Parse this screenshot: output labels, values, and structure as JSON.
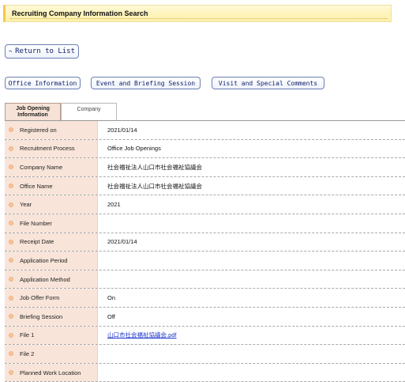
{
  "page": {
    "title": "Recruiting Company Information Search"
  },
  "actions": {
    "return_label": "Return to List"
  },
  "categories": {
    "office": "Office Information",
    "event": "Event and Briefing Session",
    "visit": "Visit and Special Comments"
  },
  "tabs": [
    {
      "label": "Job Opening Information",
      "active": true
    },
    {
      "label": "Company",
      "active": false
    }
  ],
  "fields": [
    {
      "label": "Registered on",
      "value": "2021/01/14"
    },
    {
      "label": "Recruitment Process",
      "value": "Office Job Openings"
    },
    {
      "label": "Company Name",
      "value": "社会福祉法人山口市社会福祉協議会"
    },
    {
      "label": "Office Name",
      "value": "社会福祉法人山口市社会福祉協議会"
    },
    {
      "label": "Year",
      "value": "2021"
    },
    {
      "label": "File Number",
      "value": ""
    },
    {
      "label": "Receipt Date",
      "value": "2021/01/14"
    },
    {
      "label": "Application Period",
      "value": ""
    },
    {
      "label": "Application Method",
      "value": ""
    },
    {
      "label": "Job Offer Form",
      "value": "On"
    },
    {
      "label": "Briefing Session",
      "value": "Off"
    },
    {
      "label": "File 1",
      "value": "山口市社会福祉協議会.pdf"
    },
    {
      "label": "File 2",
      "value": ""
    },
    {
      "label": "Planned Work Location",
      "value": ""
    }
  ],
  "colors": {
    "label_bg": "#f8e4d8",
    "link": "#1a33cc",
    "title_accent": "#f4c84a"
  },
  "icons": {
    "return": "return-arrow-icon",
    "row_marker": "bullet-dot-icon"
  }
}
